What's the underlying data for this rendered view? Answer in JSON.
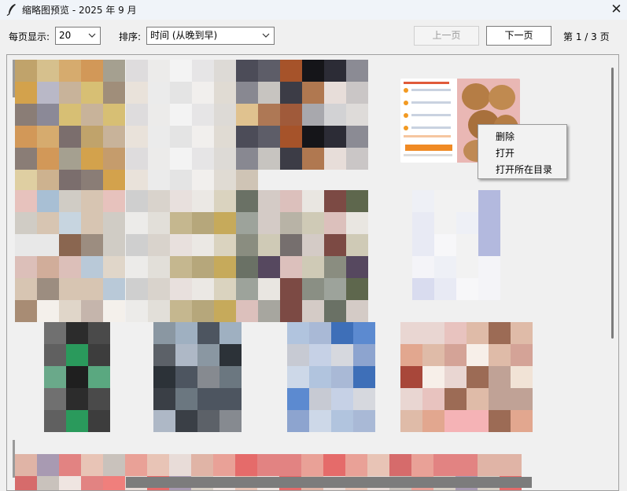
{
  "window": {
    "title": "缩略图预览 - 2025 年 9 月",
    "close_glyph": "✕"
  },
  "toolbar": {
    "per_page_label": "每页显示:",
    "per_page_value": "20",
    "sort_label": "排序:",
    "sort_value": "时间 (从晚到早)",
    "prev_label": "上一页",
    "prev_enabled": false,
    "next_label": "下一页",
    "page_info": "第 1 / 3 页"
  },
  "context_menu": {
    "items": [
      "删除",
      "打开",
      "打开所在目录"
    ]
  },
  "thumbnails": [
    {
      "name": "thumb-1",
      "kind": "pixelated",
      "palette": "warm-beige"
    },
    {
      "name": "thumb-2",
      "kind": "pixelated",
      "palette": "light-grey"
    },
    {
      "name": "thumb-3",
      "kind": "pixelated",
      "palette": "dark-grey"
    },
    {
      "name": "thumb-4",
      "kind": "screenshot",
      "palette": "cookie-ad"
    },
    {
      "name": "thumb-5",
      "kind": "pixelated",
      "palette": "mixed-rose"
    },
    {
      "name": "thumb-6",
      "kind": "pixelated",
      "palette": "olive-gold"
    },
    {
      "name": "thumb-7",
      "kind": "pixelated",
      "palette": "muted-dark"
    },
    {
      "name": "thumb-8",
      "kind": "pixelated",
      "palette": "lavender"
    },
    {
      "name": "thumb-9",
      "kind": "pixelated",
      "palette": "green-black"
    },
    {
      "name": "thumb-10",
      "kind": "pixelated",
      "palette": "slate"
    },
    {
      "name": "thumb-11",
      "kind": "pixelated",
      "palette": "blue"
    },
    {
      "name": "thumb-12",
      "kind": "pixelated",
      "palette": "red-pink"
    },
    {
      "name": "thumb-13",
      "kind": "pixelated",
      "palette": "red-row"
    }
  ],
  "colors": {
    "accent_orange": "#f08a24",
    "scrollbar": "#7c7c7c",
    "window_bg": "#f0f0f0"
  }
}
